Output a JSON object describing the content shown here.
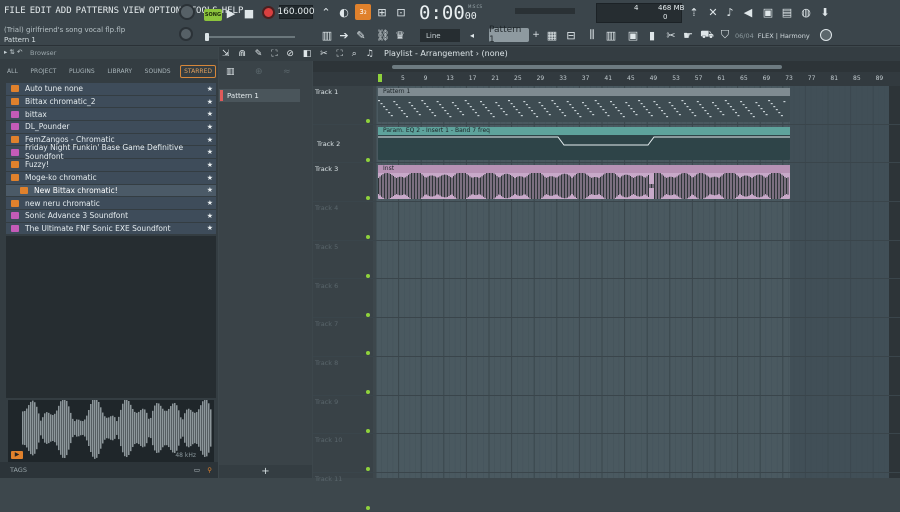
{
  "menu": [
    "FILE",
    "EDIT",
    "ADD",
    "PATTERNS",
    "VIEW",
    "OPTIONS",
    "TOOLS",
    "HELP"
  ],
  "project": {
    "title": "(Trial) girlfriend's song vocal flp.flp",
    "pattern_label": "Pattern 1"
  },
  "transport": {
    "song_label": "SONG",
    "tempo": "160.000",
    "time": "0:00",
    "time_frac": "00",
    "time_units": "M:S:CS"
  },
  "memory": {
    "cpu": "4",
    "ram": "468 MB",
    "polyphony": "0"
  },
  "toolbar": {
    "snap_mode": "Line",
    "pattern_selected": "Pattern 1",
    "harmony_count": "06/04",
    "harmony_label": "FLEX | Harmony"
  },
  "browser": {
    "title": "Browser",
    "tabs": [
      "ALL",
      "PROJECT",
      "PLUGINS",
      "LIBRARY",
      "SOUNDS",
      "STARRED"
    ],
    "active_tab": "STARRED",
    "items": [
      {
        "label": "Auto tune none",
        "icon": "folder-icon",
        "color": "#e0812c"
      },
      {
        "label": "Bittax chromatic_2",
        "icon": "folder-icon",
        "color": "#e0812c"
      },
      {
        "label": "bittax",
        "icon": "plugin-icon",
        "color": "#c45bb8"
      },
      {
        "label": "DL_Pounder",
        "icon": "plugin-icon",
        "color": "#c45bb8"
      },
      {
        "label": "FemZangos - Chromatic",
        "icon": "folder-icon",
        "color": "#e0812c"
      },
      {
        "label": "Friday Night Funkin' Base Game Definitive Soundfont",
        "icon": "plugin-icon",
        "color": "#c45bb8"
      },
      {
        "label": "Fuzzy!",
        "icon": "folder-icon",
        "color": "#e0812c"
      },
      {
        "label": "Moge-ko chromatic",
        "icon": "folder-icon",
        "color": "#e0812c"
      },
      {
        "label": "New Bittax chromatic!",
        "icon": "folder-icon",
        "color": "#e0812c"
      },
      {
        "label": "new neru chromatic",
        "icon": "folder-icon",
        "color": "#e0812c"
      },
      {
        "label": "Sonic Advance 3 Soundfont",
        "icon": "plugin-icon",
        "color": "#c45bb8"
      },
      {
        "label": "The Ultimate FNF Sonic EXE Soundfont",
        "icon": "plugin-icon",
        "color": "#c45bb8"
      }
    ],
    "selected_index": 8,
    "preview_info": "48 kHz",
    "tags_label": "TAGS"
  },
  "channel": {
    "pattern": "Pattern 1",
    "add": "+"
  },
  "playlist": {
    "title": "Playlist - Arrangement",
    "arrangement": "(none)",
    "ruler": [
      "5",
      "9",
      "13",
      "17",
      "21",
      "25",
      "29",
      "33",
      "37",
      "41",
      "45",
      "49",
      "53",
      "57",
      "61",
      "65",
      "69",
      "73",
      "77",
      "81",
      "85",
      "89"
    ],
    "tracks": [
      "Track 1",
      "Track 2",
      "Track 3",
      "Track 4",
      "Track 5",
      "Track 6",
      "Track 7",
      "Track 8",
      "Track 9",
      "Track 10",
      "Track 11"
    ],
    "clips": [
      {
        "track": 0,
        "label": "Pattern 1",
        "color": "#3e4c52",
        "head": "#7f8b91"
      },
      {
        "track": 1,
        "label": "Param. EQ 2 - Insert 1 - Band 7 freq",
        "color": "#2e4448",
        "head": "#5ea39c"
      },
      {
        "track": 2,
        "label": "Inst",
        "color": "#c8a9c9",
        "head": "#b792b5"
      }
    ]
  },
  "colors": {
    "accent": "#e0812c",
    "song": "#8cc43c",
    "track_dot": "#8fd23c"
  }
}
